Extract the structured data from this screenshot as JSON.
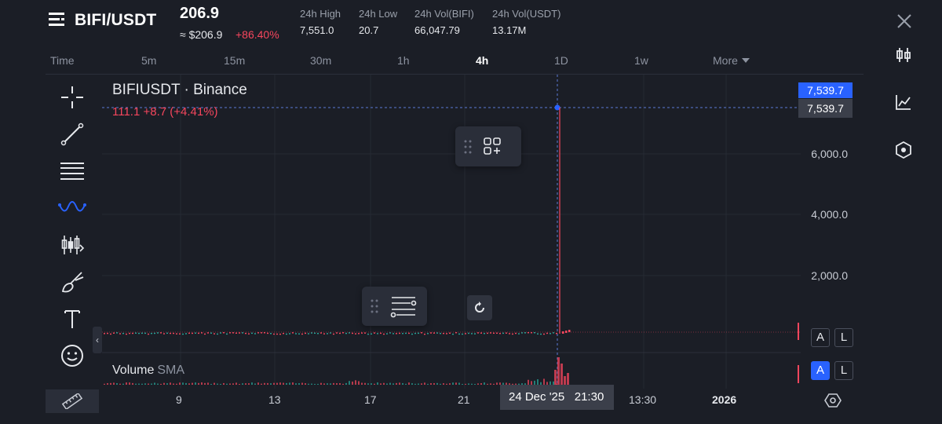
{
  "header": {
    "pair": "BIFI/USDT",
    "last_price": "206.9",
    "usd_price": "≈ $206.9",
    "change_pct": "+86.40%",
    "stats": [
      {
        "label": "24h High",
        "value": "7,551.0"
      },
      {
        "label": "24h Low",
        "value": "20.7"
      },
      {
        "label": "24h Vol(BIFI)",
        "value": "66,047.79"
      },
      {
        "label": "24h Vol(USDT)",
        "value": "13.17M"
      }
    ]
  },
  "timeframes": {
    "label": "Time",
    "items": [
      "5m",
      "15m",
      "30m",
      "1h",
      "4h",
      "1D",
      "1w"
    ],
    "active": "4h",
    "more": "More"
  },
  "chart": {
    "title": "BIFIUSDT · Binance",
    "ohlc_line": "111.1  +8.7 (+4.41%)",
    "price_axis": [
      "6,000.0",
      "4,000.0",
      "2,000.0"
    ],
    "crosshair_price": "7,539.7",
    "last_price_tag": "7,539.7",
    "volume_label": "Volume",
    "volume_indicator": "SMA",
    "alert_a": "A",
    "alert_l": "L"
  },
  "x_axis": {
    "ticks": [
      "9",
      "13",
      "17",
      "21"
    ],
    "cursor_label": "24 Dec '25   21:30",
    "after_cursor": "13:30",
    "year": "2026"
  },
  "colors": {
    "background": "#1b1e26",
    "up": "#26a69a",
    "down": "#f6465d",
    "accent": "#2962ff"
  },
  "icons": {
    "crosshair": "crosshair-icon",
    "trendline": "trend-line-icon",
    "fib": "fib-retracement-icon",
    "pattern": "pattern-icon",
    "prediction": "long-short-icon",
    "brush": "brush-icon",
    "text": "text-icon",
    "emoji": "emoji-icon",
    "ruler": "ruler-icon"
  }
}
